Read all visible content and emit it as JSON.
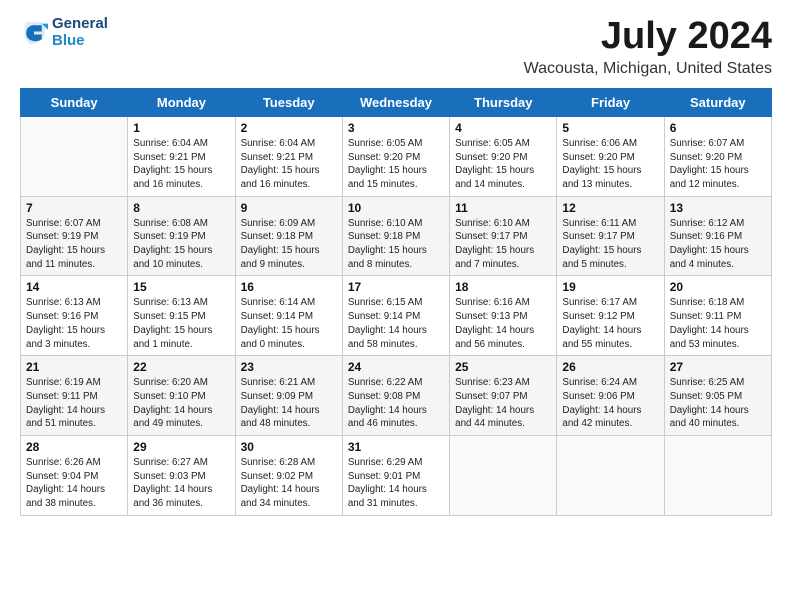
{
  "header": {
    "logo_line1": "General",
    "logo_line2": "Blue",
    "month": "July 2024",
    "location": "Wacousta, Michigan, United States"
  },
  "weekdays": [
    "Sunday",
    "Monday",
    "Tuesday",
    "Wednesday",
    "Thursday",
    "Friday",
    "Saturday"
  ],
  "weeks": [
    [
      {
        "day": "",
        "info": ""
      },
      {
        "day": "1",
        "info": "Sunrise: 6:04 AM\nSunset: 9:21 PM\nDaylight: 15 hours\nand 16 minutes."
      },
      {
        "day": "2",
        "info": "Sunrise: 6:04 AM\nSunset: 9:21 PM\nDaylight: 15 hours\nand 16 minutes."
      },
      {
        "day": "3",
        "info": "Sunrise: 6:05 AM\nSunset: 9:20 PM\nDaylight: 15 hours\nand 15 minutes."
      },
      {
        "day": "4",
        "info": "Sunrise: 6:05 AM\nSunset: 9:20 PM\nDaylight: 15 hours\nand 14 minutes."
      },
      {
        "day": "5",
        "info": "Sunrise: 6:06 AM\nSunset: 9:20 PM\nDaylight: 15 hours\nand 13 minutes."
      },
      {
        "day": "6",
        "info": "Sunrise: 6:07 AM\nSunset: 9:20 PM\nDaylight: 15 hours\nand 12 minutes."
      }
    ],
    [
      {
        "day": "7",
        "info": "Sunrise: 6:07 AM\nSunset: 9:19 PM\nDaylight: 15 hours\nand 11 minutes."
      },
      {
        "day": "8",
        "info": "Sunrise: 6:08 AM\nSunset: 9:19 PM\nDaylight: 15 hours\nand 10 minutes."
      },
      {
        "day": "9",
        "info": "Sunrise: 6:09 AM\nSunset: 9:18 PM\nDaylight: 15 hours\nand 9 minutes."
      },
      {
        "day": "10",
        "info": "Sunrise: 6:10 AM\nSunset: 9:18 PM\nDaylight: 15 hours\nand 8 minutes."
      },
      {
        "day": "11",
        "info": "Sunrise: 6:10 AM\nSunset: 9:17 PM\nDaylight: 15 hours\nand 7 minutes."
      },
      {
        "day": "12",
        "info": "Sunrise: 6:11 AM\nSunset: 9:17 PM\nDaylight: 15 hours\nand 5 minutes."
      },
      {
        "day": "13",
        "info": "Sunrise: 6:12 AM\nSunset: 9:16 PM\nDaylight: 15 hours\nand 4 minutes."
      }
    ],
    [
      {
        "day": "14",
        "info": "Sunrise: 6:13 AM\nSunset: 9:16 PM\nDaylight: 15 hours\nand 3 minutes."
      },
      {
        "day": "15",
        "info": "Sunrise: 6:13 AM\nSunset: 9:15 PM\nDaylight: 15 hours\nand 1 minute."
      },
      {
        "day": "16",
        "info": "Sunrise: 6:14 AM\nSunset: 9:14 PM\nDaylight: 15 hours\nand 0 minutes."
      },
      {
        "day": "17",
        "info": "Sunrise: 6:15 AM\nSunset: 9:14 PM\nDaylight: 14 hours\nand 58 minutes."
      },
      {
        "day": "18",
        "info": "Sunrise: 6:16 AM\nSunset: 9:13 PM\nDaylight: 14 hours\nand 56 minutes."
      },
      {
        "day": "19",
        "info": "Sunrise: 6:17 AM\nSunset: 9:12 PM\nDaylight: 14 hours\nand 55 minutes."
      },
      {
        "day": "20",
        "info": "Sunrise: 6:18 AM\nSunset: 9:11 PM\nDaylight: 14 hours\nand 53 minutes."
      }
    ],
    [
      {
        "day": "21",
        "info": "Sunrise: 6:19 AM\nSunset: 9:11 PM\nDaylight: 14 hours\nand 51 minutes."
      },
      {
        "day": "22",
        "info": "Sunrise: 6:20 AM\nSunset: 9:10 PM\nDaylight: 14 hours\nand 49 minutes."
      },
      {
        "day": "23",
        "info": "Sunrise: 6:21 AM\nSunset: 9:09 PM\nDaylight: 14 hours\nand 48 minutes."
      },
      {
        "day": "24",
        "info": "Sunrise: 6:22 AM\nSunset: 9:08 PM\nDaylight: 14 hours\nand 46 minutes."
      },
      {
        "day": "25",
        "info": "Sunrise: 6:23 AM\nSunset: 9:07 PM\nDaylight: 14 hours\nand 44 minutes."
      },
      {
        "day": "26",
        "info": "Sunrise: 6:24 AM\nSunset: 9:06 PM\nDaylight: 14 hours\nand 42 minutes."
      },
      {
        "day": "27",
        "info": "Sunrise: 6:25 AM\nSunset: 9:05 PM\nDaylight: 14 hours\nand 40 minutes."
      }
    ],
    [
      {
        "day": "28",
        "info": "Sunrise: 6:26 AM\nSunset: 9:04 PM\nDaylight: 14 hours\nand 38 minutes."
      },
      {
        "day": "29",
        "info": "Sunrise: 6:27 AM\nSunset: 9:03 PM\nDaylight: 14 hours\nand 36 minutes."
      },
      {
        "day": "30",
        "info": "Sunrise: 6:28 AM\nSunset: 9:02 PM\nDaylight: 14 hours\nand 34 minutes."
      },
      {
        "day": "31",
        "info": "Sunrise: 6:29 AM\nSunset: 9:01 PM\nDaylight: 14 hours\nand 31 minutes."
      },
      {
        "day": "",
        "info": ""
      },
      {
        "day": "",
        "info": ""
      },
      {
        "day": "",
        "info": ""
      }
    ]
  ]
}
